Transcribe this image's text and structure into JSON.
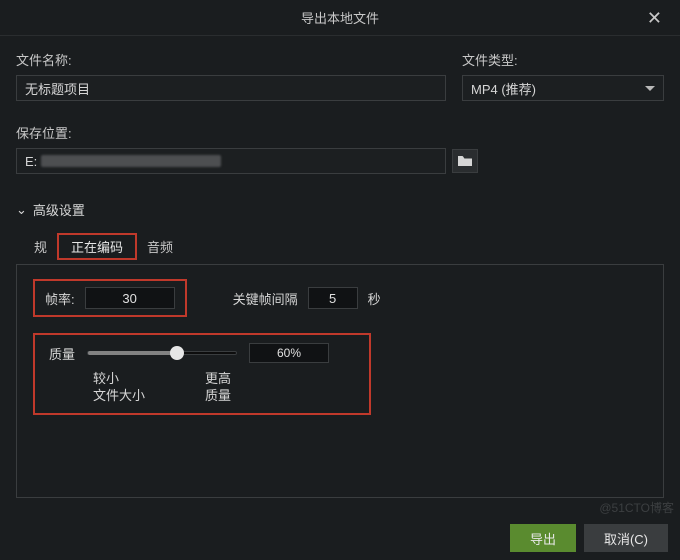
{
  "title": "导出本地文件",
  "file": {
    "name_label": "文件名称:",
    "name_value": "无标题项目",
    "type_label": "文件类型:",
    "type_value": "MP4 (推荐)"
  },
  "save": {
    "label": "保存位置:",
    "path_prefix": "E:"
  },
  "advanced": {
    "toggle": "高级设置",
    "tabs": {
      "spec_prefix": "规",
      "encoding": "正在编码",
      "audio": "音频"
    },
    "framerate": {
      "label": "帧率:",
      "value": "30"
    },
    "keyframe": {
      "label": "关键帧间隔",
      "value": "5",
      "unit": "秒"
    },
    "quality": {
      "label": "质量",
      "percent": 60,
      "percent_text": "60%",
      "min_l1": "较小",
      "min_l2": "文件大小",
      "max_l1": "更高",
      "max_l2": "质量"
    }
  },
  "footer": {
    "export": "导出",
    "cancel": "取消(C)"
  },
  "watermark": "@51CTO博客"
}
